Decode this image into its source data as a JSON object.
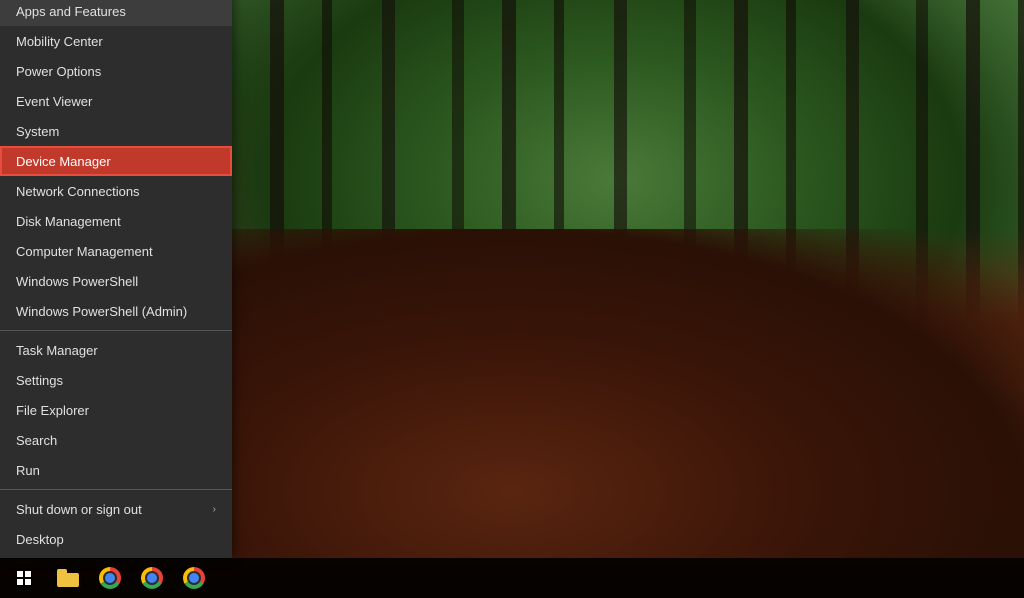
{
  "desktop": {
    "background_description": "Forest path with autumn leaves on ground"
  },
  "context_menu": {
    "items": [
      {
        "id": "apps-features",
        "label": "Apps and Features",
        "highlighted": false,
        "has_arrow": false,
        "divider_after": false
      },
      {
        "id": "mobility-center",
        "label": "Mobility Center",
        "highlighted": false,
        "has_arrow": false,
        "divider_after": false
      },
      {
        "id": "power-options",
        "label": "Power Options",
        "highlighted": false,
        "has_arrow": false,
        "divider_after": false
      },
      {
        "id": "event-viewer",
        "label": "Event Viewer",
        "highlighted": false,
        "has_arrow": false,
        "divider_after": false
      },
      {
        "id": "system",
        "label": "System",
        "highlighted": false,
        "has_arrow": false,
        "divider_after": false
      },
      {
        "id": "device-manager",
        "label": "Device Manager",
        "highlighted": true,
        "has_arrow": false,
        "divider_after": false
      },
      {
        "id": "network-connections",
        "label": "Network Connections",
        "highlighted": false,
        "has_arrow": false,
        "divider_after": false
      },
      {
        "id": "disk-management",
        "label": "Disk Management",
        "highlighted": false,
        "has_arrow": false,
        "divider_after": false
      },
      {
        "id": "computer-management",
        "label": "Computer Management",
        "highlighted": false,
        "has_arrow": false,
        "divider_after": false
      },
      {
        "id": "windows-powershell",
        "label": "Windows PowerShell",
        "highlighted": false,
        "has_arrow": false,
        "divider_after": false
      },
      {
        "id": "windows-powershell-admin",
        "label": "Windows PowerShell (Admin)",
        "highlighted": false,
        "has_arrow": false,
        "divider_after": true
      },
      {
        "id": "task-manager",
        "label": "Task Manager",
        "highlighted": false,
        "has_arrow": false,
        "divider_after": false
      },
      {
        "id": "settings",
        "label": "Settings",
        "highlighted": false,
        "has_arrow": false,
        "divider_after": false
      },
      {
        "id": "file-explorer",
        "label": "File Explorer",
        "highlighted": false,
        "has_arrow": false,
        "divider_after": false
      },
      {
        "id": "search",
        "label": "Search",
        "highlighted": false,
        "has_arrow": false,
        "divider_after": false
      },
      {
        "id": "run",
        "label": "Run",
        "highlighted": false,
        "has_arrow": false,
        "divider_after": true
      },
      {
        "id": "shut-down-sign-out",
        "label": "Shut down or sign out",
        "highlighted": false,
        "has_arrow": true,
        "divider_after": false
      },
      {
        "id": "desktop",
        "label": "Desktop",
        "highlighted": false,
        "has_arrow": false,
        "divider_after": false
      }
    ]
  },
  "taskbar": {
    "icons": [
      {
        "id": "file-explorer-taskbar",
        "type": "file-explorer"
      },
      {
        "id": "chrome-1",
        "type": "chrome"
      },
      {
        "id": "chrome-2",
        "type": "chrome"
      },
      {
        "id": "chrome-3",
        "type": "chrome"
      }
    ]
  }
}
